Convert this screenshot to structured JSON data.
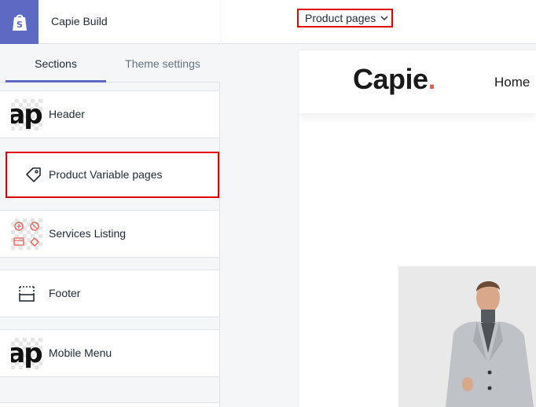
{
  "sidebar": {
    "store_name": "Capie Build",
    "tabs": [
      {
        "label": "Sections",
        "active": true
      },
      {
        "label": "Theme settings",
        "active": false
      }
    ],
    "sections": [
      {
        "label": "Header",
        "icon": "header-thumbnail-icon"
      },
      {
        "label": "Product Variable pages",
        "icon": "tag-icon"
      },
      {
        "label": "Services Listing",
        "icon": "services-thumbnail-icon"
      },
      {
        "label": "Footer",
        "icon": "footer-layout-icon"
      },
      {
        "label": "Mobile Menu",
        "icon": "mobile-menu-thumbnail-icon"
      }
    ]
  },
  "topbar": {
    "page_selector": "Product pages"
  },
  "preview": {
    "brand_name": "Capie",
    "brand_dot": ".",
    "nav_home": "Home"
  },
  "colors": {
    "accent": "#5c6ac4",
    "highlight": "#e00000",
    "brand_dot": "#e95b4f"
  }
}
